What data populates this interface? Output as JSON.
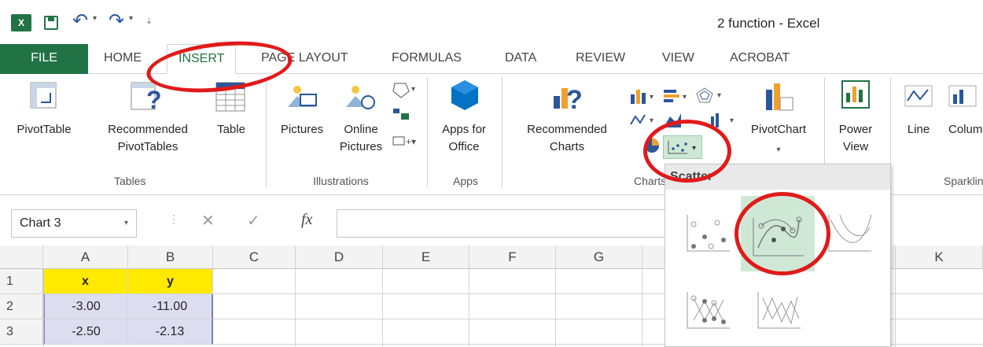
{
  "window": {
    "title": "2 function - Excel",
    "app_icon": "excel-icon"
  },
  "qat": {
    "save": "save-icon",
    "undo": "undo-icon",
    "redo": "redo-icon"
  },
  "tabs": [
    "FILE",
    "HOME",
    "INSERT",
    "PAGE LAYOUT",
    "FORMULAS",
    "DATA",
    "REVIEW",
    "VIEW",
    "ACROBAT"
  ],
  "ribbon": {
    "tables": {
      "pivottable": "PivotTable",
      "recommended_pivot_1": "Recommended",
      "recommended_pivot_2": "PivotTables",
      "table": "Table",
      "group": "Tables"
    },
    "illustrations": {
      "pictures": "Pictures",
      "online_1": "Online",
      "online_2": "Pictures",
      "group": "Illustrations"
    },
    "apps": {
      "apps_1": "Apps for",
      "apps_2": "Office",
      "group": "Apps"
    },
    "charts": {
      "recommended_1": "Recommended",
      "recommended_2": "Charts",
      "pivotchart": "PivotChart",
      "group": "Charts"
    },
    "power_view": {
      "label_1": "Power",
      "label_2": "View"
    },
    "sparklines": {
      "line": "Line",
      "column": "Column",
      "group": "Sparklines"
    }
  },
  "formula_bar": {
    "name_box": "Chart 3",
    "fx": "fx",
    "value": ""
  },
  "columns": [
    "A",
    "B",
    "C",
    "D",
    "E",
    "F",
    "G",
    "K"
  ],
  "rows": [
    {
      "num": "1",
      "a": "x",
      "b": "y"
    },
    {
      "num": "2",
      "a": "-3.00",
      "b": "-11.00"
    },
    {
      "num": "3",
      "a": "-2.50",
      "b": "-2.13"
    }
  ],
  "dropdown": {
    "title": "Scatter"
  },
  "colors": {
    "excel_green": "#217346",
    "header_yellow": "#ffea00",
    "annotation_red": "#e11a1a"
  }
}
